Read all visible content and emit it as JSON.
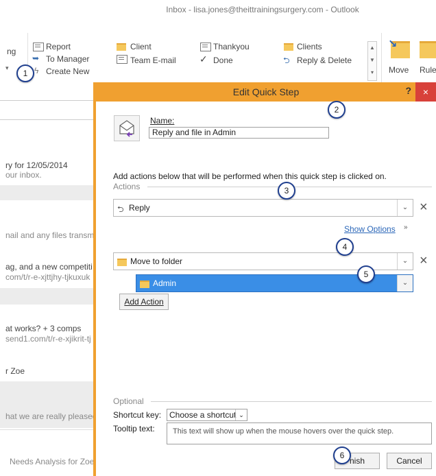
{
  "window": {
    "title": "Inbox - lisa.jones@theittrainingsurgery.com - Outlook"
  },
  "ribbon": {
    "partial_label": "ng",
    "quick_steps": [
      {
        "label": "Report",
        "icon": "envelope-icon"
      },
      {
        "label": "To Manager",
        "icon": "forward-arrow-icon"
      },
      {
        "label": "Create New",
        "icon": "lightning-icon"
      },
      {
        "label": "Client",
        "icon": "folder-icon"
      },
      {
        "label": "Team E-mail",
        "icon": "envelope-icon"
      },
      {
        "label": "Thankyou",
        "icon": "envelope-icon"
      },
      {
        "label": "Done",
        "icon": "checkmark-icon"
      },
      {
        "label": "Clients",
        "icon": "folder-icon"
      },
      {
        "label": "Reply & Delete",
        "icon": "reply-icon"
      }
    ],
    "move_label": "Move",
    "rules_label": "Rule"
  },
  "message_list": {
    "items": [
      {
        "line1": "ry for 12/05/2014",
        "line2": "our inbox."
      },
      {
        "line1": "nail and any files transm"
      },
      {
        "line1": "ag, and a new competiti",
        "line2": "com/t/r-e-xjttjhy-tjkuxuk"
      },
      {
        "line1": "at works? + 3 comps",
        "line2": "send1.com/t/r-e-xjikrit-tj"
      },
      {
        "line1": "r Zoe"
      },
      {
        "line1": "hat we are really pleased"
      },
      {
        "line1": "Needs Analysis for Zoe"
      }
    ]
  },
  "dialog": {
    "title": "Edit Quick Step",
    "help": "?",
    "close": "×",
    "name_label": "Name:",
    "name_value": "Reply and file in Admin",
    "instructions": "Add actions below that will be performed when this quick step is clicked on.",
    "actions_header": "Actions",
    "action1": {
      "label": "Reply"
    },
    "show_options": "Show Options",
    "action2": {
      "label": "Move to folder",
      "folder": "Admin"
    },
    "add_action": "Add Action",
    "optional_header": "Optional",
    "shortcut_label": "Shortcut key:",
    "shortcut_value": "Choose a shortcut",
    "tooltip_label": "Tooltip text:",
    "tooltip_value": "This text will show up when the mouse hovers over the quick step.",
    "finish": "nish",
    "cancel": "Cancel",
    "remove": "×"
  },
  "callouts": [
    "1",
    "2",
    "3",
    "4",
    "5",
    "6"
  ],
  "colors": {
    "accent": "#f0a030",
    "selection": "#3a8ee6",
    "callout_border": "#1f3f8f",
    "close": "#d8413a"
  }
}
